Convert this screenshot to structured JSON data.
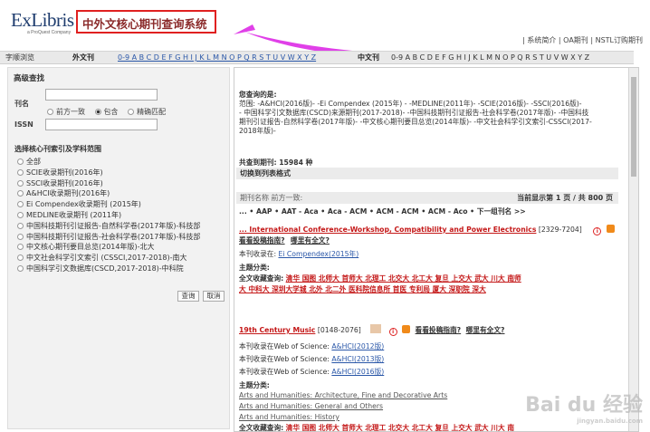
{
  "logo": {
    "main": "ExLibris",
    "sub": "a ProQuest Company"
  },
  "header": {
    "title": "中外文核心期刊查询系统",
    "links": "| 系统简介 | OA期刊 | NSTL订购期刊"
  },
  "alpha": {
    "label": "字顺浏览",
    "foreign": "外文刊",
    "foreign_letters": "0-9 A B C D E F G H I J K L M N O P Q R S T U V W X Y Z",
    "chinese": "中文刊",
    "chinese_letters": "0-9 A B C D E F G H I J K L M N O P Q R S T U V W X Y Z"
  },
  "search": {
    "title": "高级查找",
    "label_journal": "刊名",
    "opt_prefix": "前方一致",
    "opt_contain": "包含",
    "opt_exact": "精确匹配",
    "label_issn": "ISSN",
    "scope_title": "选择核心刊索引及学科范围",
    "scopes": [
      "全部",
      "SCIE收录期刊(2016年)",
      "SSCI收录期刊(2016年)",
      "A&HCI收录期刊(2016年)",
      "Ei Compendex收录期刊 (2015年)",
      "MEDLINE收录期刊 (2011年)",
      "中国科技期刊引证报告-自然科学卷(2017年版)-科技部",
      "中国科技期刊引证报告-社会科学卷(2017年版)-科技部",
      "中文核心期刊要目总览(2014年版)-北大",
      "中文社会科学引文索引 (CSSCI,2017-2018)-南大",
      "中国科学引文数据库(CSCD,2017-2018)-中科院"
    ],
    "search_btn": "查询",
    "cancel_btn": "取消"
  },
  "results": {
    "query_label": "您查询的是:",
    "scope_line1": "范围:   -A&HCI(2016版)-   -Ei Compendex (2015年) -   -MEDLINE(2011年)-   -SCIE(2016版)-   -SSCI(2016版)-",
    "scope_line2": "- 中国科学引文数据库(CSCD)来源期刊(2017-2018)-   -中国科技期刊引证报告-社会科学卷(2017年版)-   -中国科技",
    "scope_line3": "期刊引证报告-自然科学卷(2017年版)-   -中文核心期刊要目总览(2014年版)-   -中文社会科学引文索引-CSSCI(2017-",
    "scope_line4": "2018年版)-",
    "total": "共查到期刊: 15984 种",
    "switch": "切换到列表格式",
    "sort": "期刊名称 前方一致:",
    "page_info": "当前显示第 1 页 / 共 800 页",
    "nav": "... • AAP • AAT - Aca • Aca - ACM • ACM - ACM • ACM - Aco • 下一组刊名 >>",
    "entries": [
      {
        "title": "... International Conference-Workshop, Compatibility and Power Electronics",
        "issn": "[2329-7204]",
        "guide": "看看投稿指南?",
        "full": "哪里有全文?",
        "index_label": "本刊收录在:",
        "index": "Ei Compendex(2015年)",
        "subject_label": "主题分类:",
        "holdings_label": "全文收藏查询:",
        "libs1": "清华  国图  北师大  首师大  北理工  北交大  北工大  复旦  上交大  武大  川大  南师",
        "libs2": "大  中科大  深圳大学城  北外  北二外  医科院信息所  首医  专利局  厦大  深职院  深大"
      },
      {
        "title": "19th Century Music",
        "issn": "[0148-2076]",
        "guide": "看看投稿指南?",
        "full": "哪里有全文?",
        "wos_label": "本刊收录在Web of Science:",
        "wos": [
          "A&HCI(2012版)",
          "A&HCI(2013版)",
          "A&HCI(2016版)"
        ],
        "subject_label": "主题分类:",
        "subjects": [
          "Arts and Humanities: Architecture, Fine and Decorative Arts",
          "Arts and Humanities: General and Others",
          "Arts and Humanities: History"
        ],
        "holdings_label": "全文收藏查询:",
        "libs": "清华  国图  北师大  首师大  北理工  北交大  北工大  复旦  上交大  武大  川大  南"
      }
    ]
  },
  "watermark": {
    "main": "Bai du 经验",
    "sub": "jingyan.baidu.com"
  },
  "colors": {
    "accent_red": "#e02020",
    "arrow": "#e040e8"
  }
}
